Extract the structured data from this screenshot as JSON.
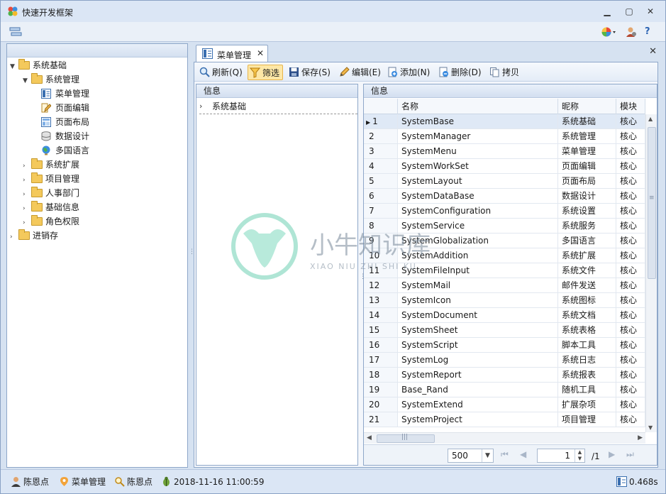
{
  "window": {
    "title": "快速开发框架",
    "minimize": "▁",
    "maximize": "▢",
    "close": "✕"
  },
  "tree": {
    "items": [
      {
        "label": "系统基础",
        "arrow": "▼"
      },
      {
        "label": "系统管理",
        "arrow": "▼"
      },
      {
        "label": "菜单管理"
      },
      {
        "label": "页面编辑"
      },
      {
        "label": "页面布局"
      },
      {
        "label": "数据设计"
      },
      {
        "label": "多国语言"
      },
      {
        "label": "系统扩展",
        "arrow": "›"
      },
      {
        "label": "项目管理",
        "arrow": "›"
      },
      {
        "label": "人事部门",
        "arrow": "›"
      },
      {
        "label": "基础信息",
        "arrow": "›"
      },
      {
        "label": "角色权限",
        "arrow": "›"
      },
      {
        "label": "进销存",
        "arrow": "›"
      }
    ]
  },
  "tab": {
    "label": "菜单管理",
    "close": "✕",
    "doc_close": "✕"
  },
  "toolbar": {
    "refresh": "刷新(Q)",
    "filter": "筛选",
    "save": "保存(S)",
    "edit": "编辑(E)",
    "add": "添加(N)",
    "delete": "删除(D)",
    "copy": "拷贝"
  },
  "middle": {
    "header": "信息",
    "row": "系统基础",
    "arrow": "›"
  },
  "grid": {
    "header": "信息",
    "columns": [
      "名称",
      "昵称",
      "模块"
    ],
    "rows": [
      {
        "n": "1",
        "name": "SystemBase",
        "nick": "系统基础",
        "mod": "核心"
      },
      {
        "n": "2",
        "name": "SystemManager",
        "nick": "系统管理",
        "mod": "核心"
      },
      {
        "n": "3",
        "name": "SystemMenu",
        "nick": "菜单管理",
        "mod": "核心"
      },
      {
        "n": "4",
        "name": "SystemWorkSet",
        "nick": "页面编辑",
        "mod": "核心"
      },
      {
        "n": "5",
        "name": "SystemLayout",
        "nick": "页面布局",
        "mod": "核心"
      },
      {
        "n": "6",
        "name": "SystemDataBase",
        "nick": "数据设计",
        "mod": "核心"
      },
      {
        "n": "7",
        "name": "SystemConfiguration",
        "nick": "系统设置",
        "mod": "核心"
      },
      {
        "n": "8",
        "name": "SystemService",
        "nick": "系统服务",
        "mod": "核心"
      },
      {
        "n": "9",
        "name": "SystemGlobalization",
        "nick": "多国语言",
        "mod": "核心"
      },
      {
        "n": "10",
        "name": "SystemAddition",
        "nick": "系统扩展",
        "mod": "核心"
      },
      {
        "n": "11",
        "name": "SystemFileInput",
        "nick": "系统文件",
        "mod": "核心"
      },
      {
        "n": "12",
        "name": "SystemMail",
        "nick": "邮件发送",
        "mod": "核心"
      },
      {
        "n": "13",
        "name": "SystemIcon",
        "nick": "系统图标",
        "mod": "核心"
      },
      {
        "n": "14",
        "name": "SystemDocument",
        "nick": "系统文档",
        "mod": "核心"
      },
      {
        "n": "15",
        "name": "SystemSheet",
        "nick": "系统表格",
        "mod": "核心"
      },
      {
        "n": "16",
        "name": "SystemScript",
        "nick": "脚本工具",
        "mod": "核心"
      },
      {
        "n": "17",
        "name": "SystemLog",
        "nick": "系统日志",
        "mod": "核心"
      },
      {
        "n": "18",
        "name": "SystemReport",
        "nick": "系统报表",
        "mod": "核心"
      },
      {
        "n": "19",
        "name": "Base_Rand",
        "nick": "随机工具",
        "mod": "核心"
      },
      {
        "n": "20",
        "name": "SystemExtend",
        "nick": "扩展杂项",
        "mod": "核心"
      },
      {
        "n": "21",
        "name": "SystemProject",
        "nick": "项目管理",
        "mod": "核心"
      }
    ]
  },
  "pager": {
    "page_size": "500",
    "page": "1",
    "total": "/1"
  },
  "status": {
    "user": "陈恩点",
    "menu": "菜单管理",
    "user2": "陈恩点",
    "time": "2018-11-16 11:00:59",
    "elapsed": "0.468s"
  },
  "watermark": {
    "title": "小牛知识库",
    "sub": "XIAO NIU ZHI SHI KU"
  },
  "colors": {
    "accent": "#3a6fb0",
    "active_tool": "#fde7a6",
    "selected_row": "#dfe9f6",
    "border": "#8ea7c9"
  }
}
